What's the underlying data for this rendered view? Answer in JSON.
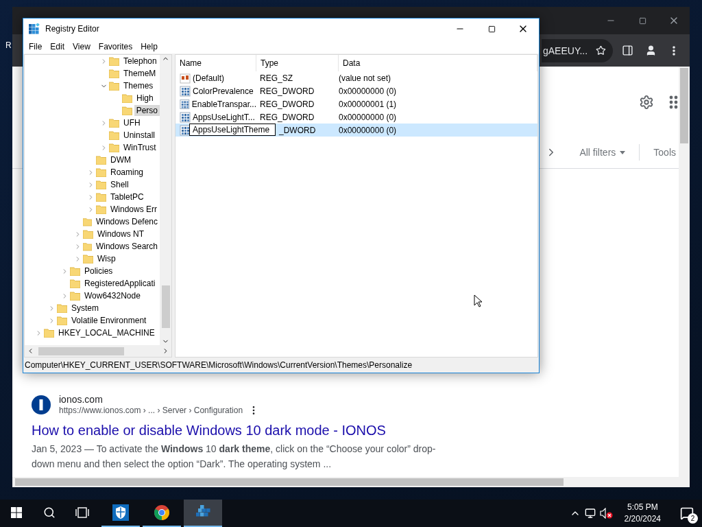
{
  "desktop": {
    "icon_label": "R"
  },
  "browser": {
    "address_text": "gAEEUY...",
    "filters": [
      {
        "label": "All filters",
        "dropdown": true
      },
      {
        "label": "Tools",
        "dropdown": false
      }
    ],
    "result": {
      "site": "ionos.com",
      "url": "https://www.ionos.com › ... › Server › Configuration",
      "title": "How to enable or disable Windows 10 dark mode - IONOS",
      "snippet": "Jan 5, 2023 — To activate the **Windows** 10 **dark theme**, click on the “Choose your color” drop-down menu and then select the option “Dark”. The operating system ..."
    }
  },
  "registry": {
    "title": "Registry Editor",
    "menu": [
      "File",
      "Edit",
      "View",
      "Favorites",
      "Help"
    ],
    "tree": [
      {
        "children": [
          {
            "children": [
              {
                "children": [
                  {
                    "children": [
                      {
                        "children": [
                          {
                            "label": "Telephon",
                            "expandable": true,
                            "expanded": false,
                            "selected": false
                          },
                          {
                            "label": "ThemeM",
                            "expandable": false,
                            "selected": false
                          },
                          {
                            "label": "Themes",
                            "expandable": true,
                            "expanded": true,
                            "selected": false,
                            "children": [
                              {
                                "label": "High",
                                "expandable": false,
                                "selected": false
                              },
                              {
                                "label": "Perso",
                                "expandable": false,
                                "selected": true
                              }
                            ]
                          },
                          {
                            "label": "UFH",
                            "expandable": true,
                            "expanded": false,
                            "selected": false
                          },
                          {
                            "label": "Uninstall",
                            "expandable": false,
                            "selected": false
                          },
                          {
                            "label": "WinTrust",
                            "expandable": true,
                            "expanded": false,
                            "selected": false
                          }
                        ]
                      },
                      {
                        "label": "DWM",
                        "expandable": false,
                        "selected": false
                      },
                      {
                        "label": "Roaming",
                        "expandable": true,
                        "expanded": false,
                        "selected": false
                      },
                      {
                        "label": "Shell",
                        "expandable": true,
                        "expanded": false,
                        "selected": false
                      },
                      {
                        "label": "TabletPC",
                        "expandable": true,
                        "expanded": false,
                        "selected": false
                      },
                      {
                        "label": "Windows Err",
                        "expandable": true,
                        "expanded": false,
                        "selected": false
                      }
                    ]
                  },
                  {
                    "label": "Windows Defenc",
                    "expandable": false,
                    "selected": false
                  },
                  {
                    "label": "Windows NT",
                    "expandable": true,
                    "expanded": false,
                    "selected": false
                  },
                  {
                    "label": "Windows Search",
                    "expandable": true,
                    "expanded": false,
                    "selected": false
                  },
                  {
                    "label": "Wisp",
                    "expandable": true,
                    "expanded": false,
                    "selected": false
                  }
                ]
              },
              {
                "label": "Policies",
                "expandable": true,
                "expanded": false,
                "selected": false
              },
              {
                "label": "RegisteredApplicati",
                "expandable": false,
                "selected": false
              },
              {
                "label": "Wow6432Node",
                "expandable": true,
                "expanded": false,
                "selected": false
              }
            ]
          },
          {
            "label": "System",
            "expandable": true,
            "expanded": false,
            "selected": false
          },
          {
            "label": "Volatile Environment",
            "expandable": true,
            "expanded": false,
            "selected": false
          }
        ]
      },
      {
        "label": "HKEY_LOCAL_MACHINE",
        "expandable": true,
        "expanded": false,
        "selected": false
      }
    ],
    "columns": [
      "Name",
      "Type",
      "Data"
    ],
    "values": [
      {
        "kind": "string",
        "name": "(Default)",
        "type": "REG_SZ",
        "data": "(value not set)",
        "selected": false,
        "editing": false
      },
      {
        "kind": "binary",
        "name": "ColorPrevalence",
        "type": "REG_DWORD",
        "data": "0x00000000 (0)",
        "selected": false,
        "editing": false
      },
      {
        "kind": "binary",
        "name": "EnableTranspar...",
        "type": "REG_DWORD",
        "data": "0x00000001 (1)",
        "selected": false,
        "editing": false
      },
      {
        "kind": "binary",
        "name": "AppsUseLightT...",
        "type": "REG_DWORD",
        "data": "0x00000000 (0)",
        "selected": false,
        "editing": false
      },
      {
        "kind": "binary",
        "name": "AppsUseLightTheme",
        "type": "_DWORD",
        "data": "0x00000000 (0)",
        "selected": true,
        "editing": true
      }
    ],
    "status": "Computer\\HKEY_CURRENT_USER\\SOFTWARE\\Microsoft\\Windows\\CurrentVersion\\Themes\\Personalize"
  },
  "taskbar": {
    "apps": [
      {
        "kind": "defender",
        "active": false
      },
      {
        "kind": "chrome",
        "active": false
      },
      {
        "kind": "regedit",
        "active": true
      }
    ],
    "time": "5:05 PM",
    "date": "2/20/2024",
    "notifications": "2"
  }
}
